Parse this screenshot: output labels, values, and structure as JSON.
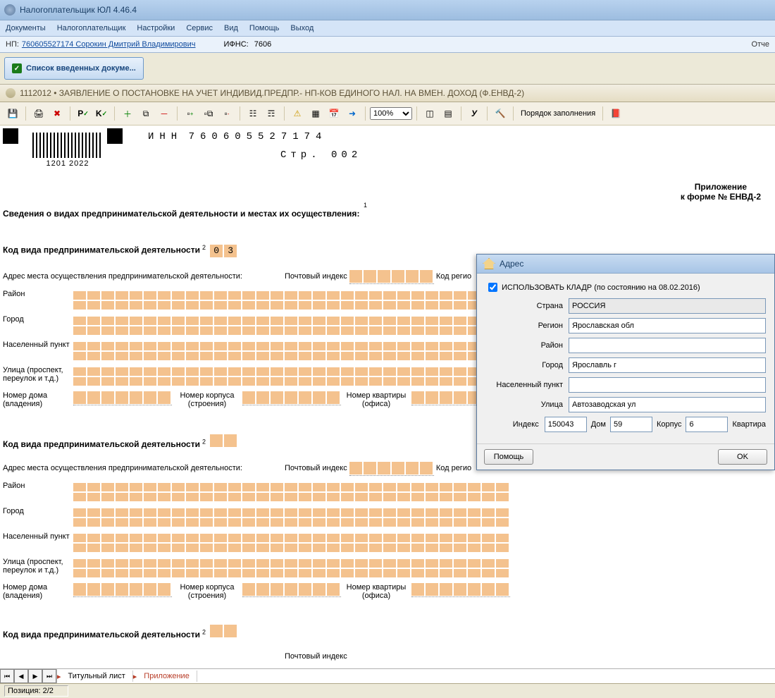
{
  "window": {
    "title": "Налогоплательщик ЮЛ 4.46.4"
  },
  "menu": {
    "items": [
      "Документы",
      "Налогоплательщик",
      "Настройки",
      "Сервис",
      "Вид",
      "Помощь",
      "Выход"
    ]
  },
  "status": {
    "np_label": "НП:",
    "np_link": "760605527174 Сорокин Дмитрий Владимирович",
    "ifns_label": "ИФНС:",
    "ifns_value": "7606",
    "right": "Отче"
  },
  "big_button": {
    "label": "Список введенных докуме..."
  },
  "document": {
    "header": "1112012 • ЗАЯВЛЕНИЕ О ПОСТАНОВКЕ НА УЧЕТ ИНДИВИД.ПРЕДПР.- НП-КОВ ЕДИНОГО НАЛ. НА ВМЕН.  ДОХОД (Ф.ЕНВД-2)"
  },
  "toolbar": {
    "zoom": "100%",
    "link_text": "Порядок заполнения",
    "icons": [
      "save-icon",
      "print-icon",
      "delete-icon",
      "p-icon",
      "k-icon",
      "plus-icon",
      "copy-icon",
      "minus-icon",
      "tree-plus-icon",
      "tree-copy-icon",
      "tree-minus-icon",
      "tree1-icon",
      "tree2-icon",
      "check-icon",
      "grid-icon",
      "calendar-icon",
      "right-arrow-icon",
      "layout1-icon",
      "layout2-icon",
      "y-icon",
      "hammer-icon",
      "book-icon"
    ]
  },
  "form": {
    "inn_label": "ИНН",
    "inn": "760605527174",
    "page_label": "Стр.",
    "page": "002",
    "barcode": "1201 2022",
    "appendix_line1": "Приложение",
    "appendix_line2": "к форме № ЕНВД-2",
    "sup1": "1",
    "heading": "Сведения о видах предпринимательской деятельности и местах их осуществления",
    "colon": ":",
    "block1": {
      "code_label": "Код вида предпринимательской деятельности",
      "sup": "2",
      "code": "03",
      "addr_label": "Адрес места осуществления предпринимательской деятельности:",
      "post_label": "Почтовый индекс",
      "region_label": "Код регио",
      "rayon": "Район",
      "city": "Город",
      "settlement": "Населенный пункт",
      "street": "Улица (проспект, переулок и т.д.)",
      "house": "Номер дома (владения)",
      "korpus": "Номер корпуса (строения)",
      "flat": "Номер квартиры (офиса)"
    },
    "block3_post": "Почтовый индекс"
  },
  "tabs": {
    "items": [
      "Титульный лист",
      "Приложение"
    ],
    "active": 1
  },
  "footer": {
    "pos": "Позиция: 2/2"
  },
  "dialog": {
    "title": "Адрес",
    "use_kladr": "ИСПОЛЬЗОВАТЬ КЛАДР (по состоянию на 08.02.2016)",
    "rows": {
      "country_l": "Страна",
      "country_v": "РОССИЯ",
      "region_l": "Регион",
      "region_v": "Ярославская обл",
      "rayon_l": "Район",
      "rayon_v": "",
      "city_l": "Город",
      "city_v": "Ярославль г",
      "settle_l": "Населенный пункт",
      "settle_v": "",
      "street_l": "Улица",
      "street_v": "Автозаводская ул",
      "index_l": "Индекс",
      "index_v": "150043",
      "house_l": "Дом",
      "house_v": "59",
      "korpus_l": "Корпус",
      "korpus_v": "6",
      "flat_l": "Квартира",
      "flat_v": ""
    },
    "btn_help": "Помощь",
    "btn_ok": "OK"
  }
}
